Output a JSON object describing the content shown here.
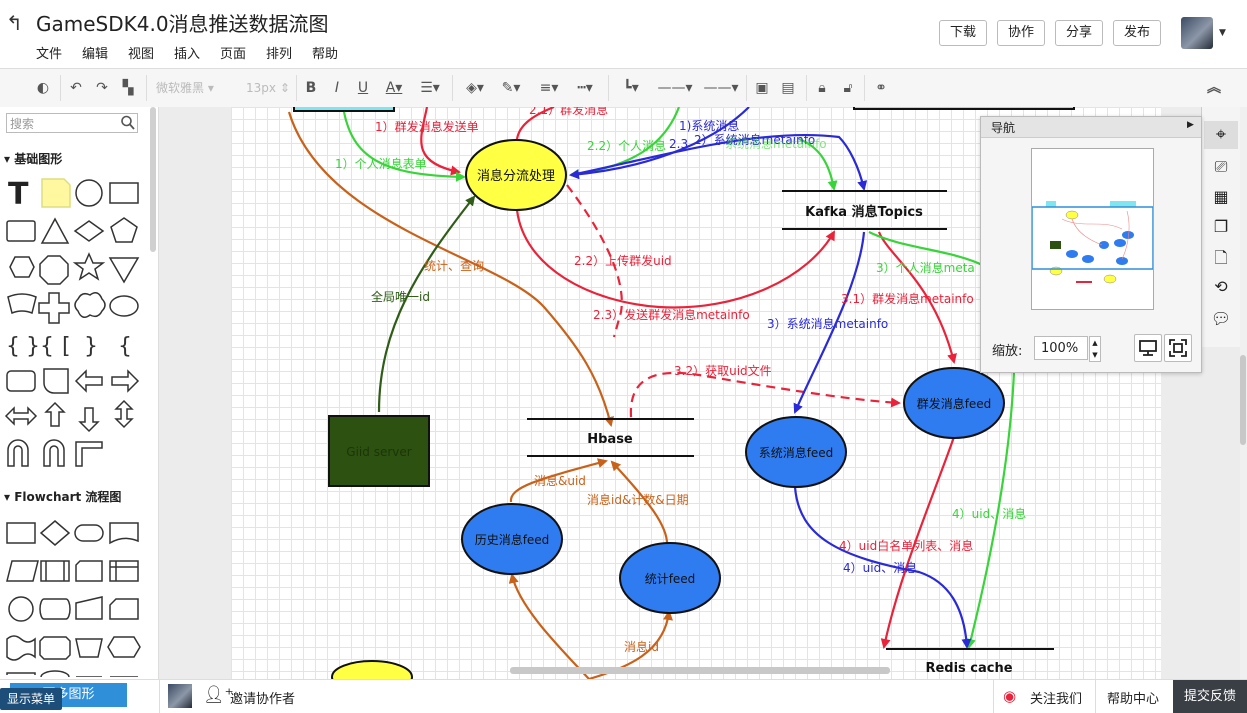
{
  "header": {
    "title": "GameSDK4.0消息推送数据流图",
    "menus": [
      "文件",
      "编辑",
      "视图",
      "插入",
      "页面",
      "排列",
      "帮助"
    ],
    "buttons": [
      "下载",
      "协作",
      "分享",
      "发布"
    ]
  },
  "toolbar": {
    "font": "微软雅黑",
    "size": "13px"
  },
  "sidebar": {
    "search_placeholder": "搜索",
    "sections": [
      "基础图形",
      "Flowchart 流程图"
    ]
  },
  "navigator": {
    "title": "导航",
    "zoom_label": "缩放:",
    "zoom_value": "100%"
  },
  "bottom": {
    "more_shapes": "更多图形",
    "show_menu": "显示菜单",
    "invite": "邀请协作者",
    "follow": "关注我们",
    "help": "帮助中心",
    "feedback": "提交反馈"
  },
  "diagram": {
    "nodes": {
      "dispatch": "消息分流处理",
      "kafka": "Kafka 消息Topics",
      "hbase": "Hbase",
      "gid": "Giid server",
      "history_feed": "历史消息feed",
      "stats_feed": "统计feed",
      "system_feed": "系统消息feed",
      "group_feed": "群发消息feed",
      "redis": "Redis cache"
    },
    "edge_labels": {
      "l1": "1）群发消息发送单",
      "l2": "1）个人消息表单",
      "l3": "2.1）群发消息",
      "l4": "2.2）个人消息",
      "l5": "2.3",
      "l6": "1)系统消息",
      "l7": "2）系统消息metainfo",
      "l8": "系统消息metainfo",
      "l9": "统计、查询",
      "l10": "全局唯一id",
      "l11": "2.2）上传群发uid",
      "l12": "2.3）发送群发消息metainfo",
      "l13": "3）系统消息metainfo",
      "l14": "3.1）群发消息metainfo",
      "l15": "3）个人消息meta",
      "l16": "3.2）获取uid文件",
      "l17": "消息&uid",
      "l18": "消息id&计数&日期",
      "l19": "4）uid、消息",
      "l20": "4）uid白名单列表、消息",
      "l21": "4）uid、消息",
      "l22": "消息id"
    }
  },
  "colors": {
    "red": "#e8233a",
    "blue": "#2a2ad6",
    "green": "#39d439",
    "orange": "#c8621a",
    "darkgreen": "#2f5c17",
    "yellow": "#ffff44",
    "node_blue": "#2e7cf0"
  }
}
